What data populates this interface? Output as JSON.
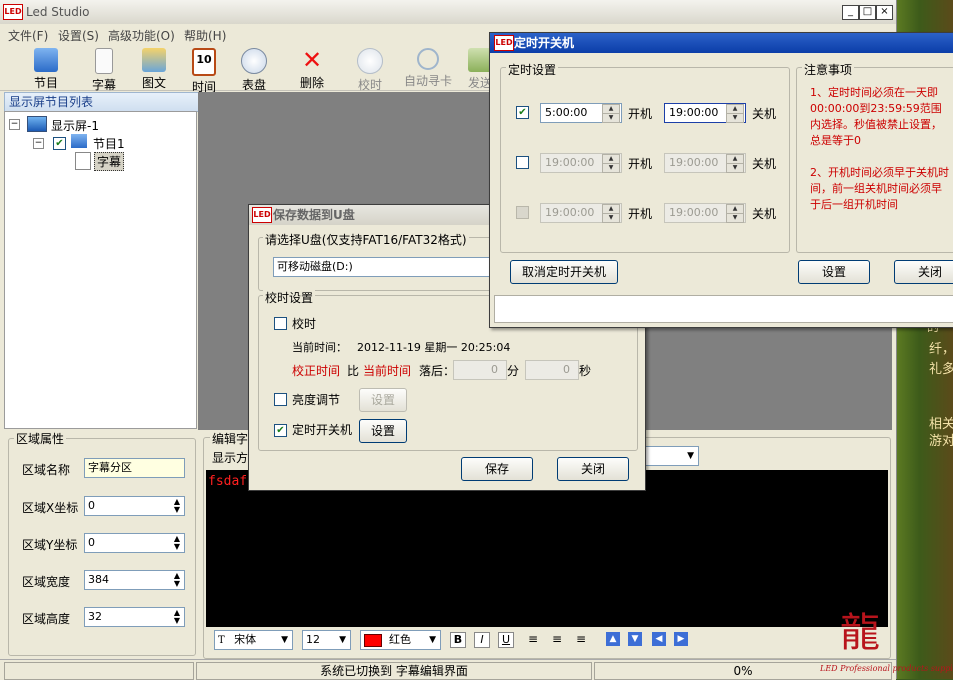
{
  "app": {
    "title": "Led Studio",
    "logo_text": "LED"
  },
  "menu": [
    "文件(F)",
    "设置(S)",
    "高级功能(O)",
    "帮助(H)"
  ],
  "toolbar": {
    "items": [
      {
        "label": "节目",
        "icon": "program-icon"
      },
      {
        "label": "字幕",
        "icon": "subtitle-icon"
      },
      {
        "label": "图文",
        "icon": "image-text-icon"
      },
      {
        "label": "时间",
        "icon": "calendar-icon"
      },
      {
        "label": "表盘",
        "icon": "clock-dial-icon"
      },
      {
        "label": "删除",
        "icon": "delete-x-icon"
      },
      {
        "label": "校时",
        "icon": "time-sync-icon"
      },
      {
        "label": "自动寻卡",
        "icon": "search-card-icon"
      },
      {
        "label": "发送",
        "icon": "send-icon"
      }
    ]
  },
  "left_panel": {
    "header": "显示屏节目列表",
    "tree": {
      "screen": "显示屏-1",
      "program": "节目1",
      "subtitle": "字幕"
    }
  },
  "area_props": {
    "legend": "区域属性",
    "name_label": "区域名称",
    "name_value": "字幕分区",
    "x_label": "区域X坐标",
    "x_value": "0",
    "y_label": "区域Y坐标",
    "y_value": "0",
    "width_label": "区域宽度",
    "width_value": "384",
    "height_label": "区域高度",
    "height_value": "32"
  },
  "editor": {
    "legend": "编辑字",
    "display_label": "显示方",
    "content": "fsdaf",
    "font": "宋体",
    "size": "12",
    "color_name": "红色",
    "color_hex": "#ff0000"
  },
  "status": {
    "message": "系统已切换到 字幕编辑界面",
    "progress": "0%"
  },
  "save_dialog": {
    "title": "保存数据到U盘",
    "udisk_legend": "请选择U盘(仅支持FAT16/FAT32格式)",
    "udisk_value": "可移动磁盘(D:)",
    "time_legend": "校时设置",
    "sync_label": "校时",
    "current_time_label": "当前时间：",
    "current_time_value": "2012-11-19 星期一 20:25:04",
    "correct_label": "校正时间",
    "compare_label": "比",
    "current_label": "当前时间",
    "delay_label": "落后：",
    "min_value": "0",
    "min_unit": "分",
    "sec_value": "0",
    "sec_unit": "秒",
    "brightness_label": "亮度调节",
    "brightness_btn": "设置",
    "timer_label": "定时开关机",
    "timer_btn": "设置",
    "save_btn": "保存",
    "close_btn": "关闭"
  },
  "timer_dialog": {
    "title": "定时开关机",
    "legend": "定时设置",
    "rows": [
      {
        "on": "5:00:00",
        "on_label": "开机",
        "off": "19:00:00",
        "off_label": "关机",
        "checked": true
      },
      {
        "on": "19:00:00",
        "on_label": "开机",
        "off": "19:00:00",
        "off_label": "关机",
        "checked": false
      },
      {
        "on": "19:00:00",
        "on_label": "开机",
        "off": "19:00:00",
        "off_label": "关机",
        "checked": false
      }
    ],
    "notes_legend": "注意事项",
    "note1": "1、定时时间必须在一天即00:00:00到23:59:59范围内选择。秒值被禁止设置，总是等于0",
    "note2": "2、开机时间必须早于关机时间，前一组关机时间必须早于后一组开机时间",
    "cancel_btn": "取消定时开关机",
    "set_btn": "设置",
    "close_btn": "关闭"
  },
  "side_art": {
    "text1": "的",
    "text2": "纤，",
    "text3": "礼多",
    "text4": "相关",
    "text5": "游对",
    "caption": "LED Professional products supplier"
  }
}
